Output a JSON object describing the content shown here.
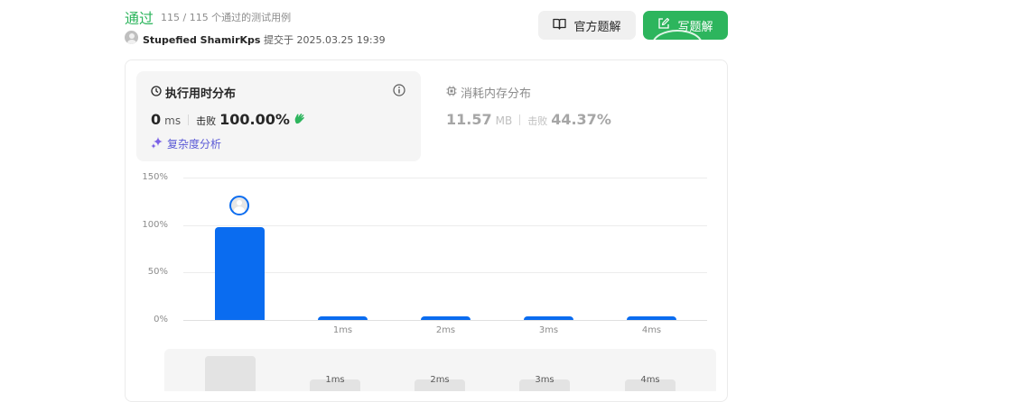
{
  "header": {
    "status": "通过",
    "testcases": "115 / 115 个通过的测试用例",
    "username": "Stupefied ShamirKps",
    "submitted_prefix": "提交于",
    "submitted_time": "2025.03.25 19:39"
  },
  "buttons": {
    "official": "官方题解",
    "write": "写题解"
  },
  "runtime": {
    "title": "执行用时分布",
    "value": "0",
    "unit": "ms",
    "beat_label": "击败",
    "beat_value": "100.00%"
  },
  "memory": {
    "title": "消耗内存分布",
    "value": "11.57",
    "unit": "MB",
    "beat_label": "击败",
    "beat_value": "44.37%"
  },
  "complexity_link": "复杂度分析",
  "colors": {
    "accept_green": "#2db55d",
    "bar_blue": "#0a6cf0",
    "complexity_purple": "#5b5ad6"
  },
  "chart_data": {
    "type": "bar",
    "y_tick_labels": [
      "150%",
      "100%",
      "50%",
      "0%"
    ],
    "ylim": [
      0,
      150
    ],
    "categories": [
      "0ms",
      "1ms",
      "2ms",
      "3ms",
      "4ms"
    ],
    "x_tick_labels": [
      "",
      "1ms",
      "2ms",
      "3ms",
      "4ms"
    ],
    "values": [
      98,
      4,
      4,
      4,
      4
    ],
    "user_bin": 0,
    "grid": true
  },
  "minimap": {
    "labels": [
      "1ms",
      "2ms",
      "3ms",
      "4ms"
    ]
  }
}
